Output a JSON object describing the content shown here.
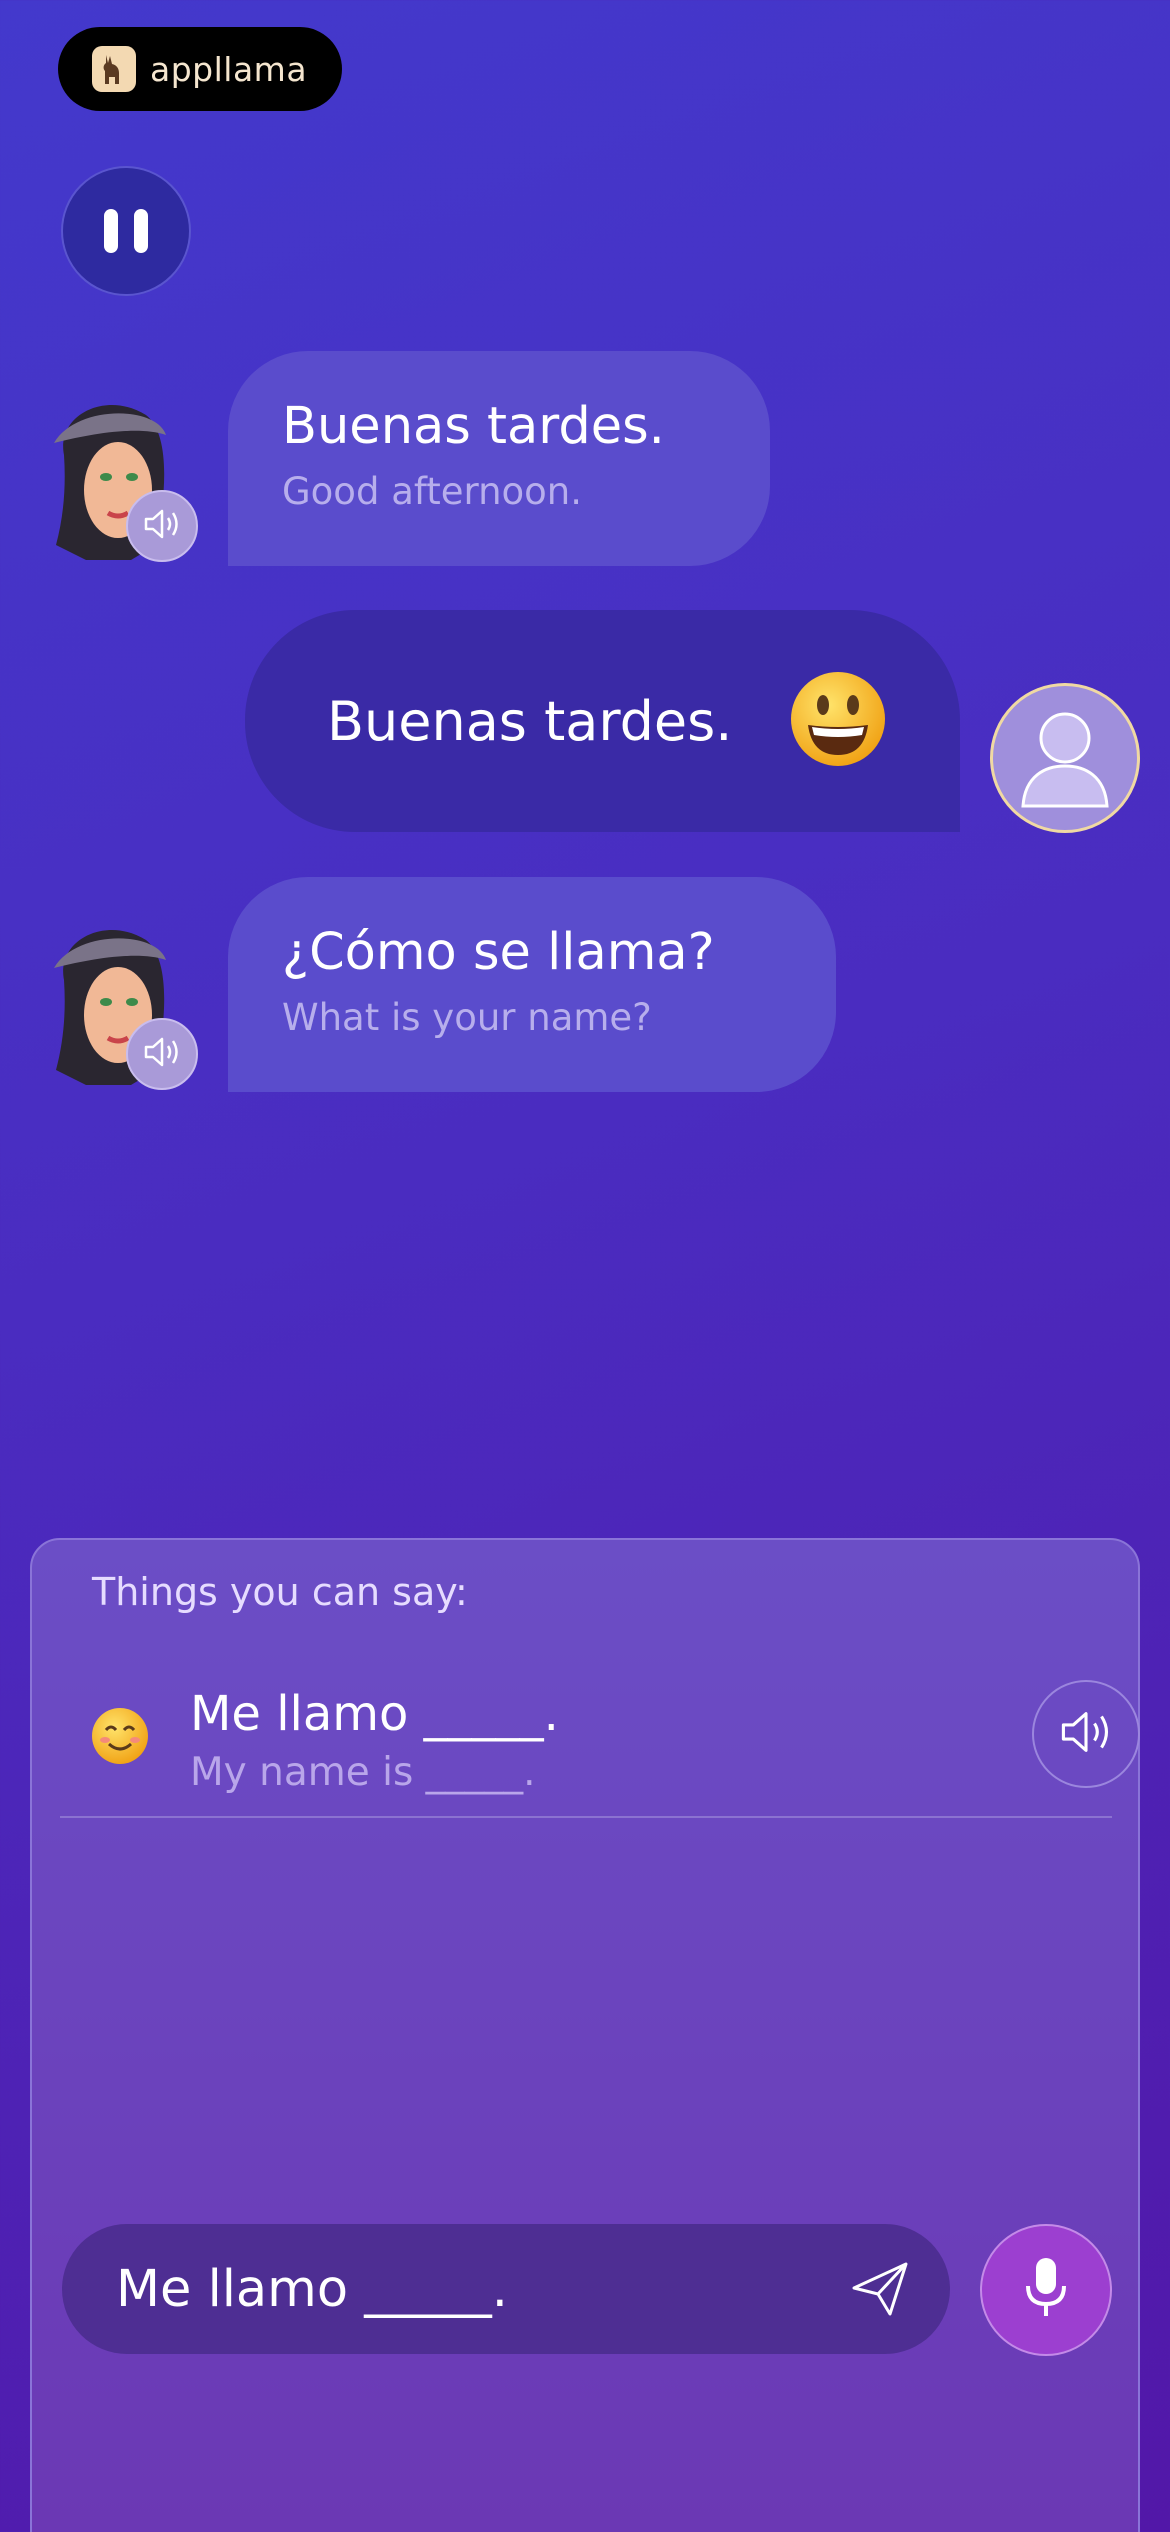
{
  "app": {
    "brand": "appllama"
  },
  "controls": {
    "pause_icon": "pause-icon"
  },
  "conversation": [
    {
      "speaker": "tutor",
      "text": "Buenas tardes.",
      "translation": "Good afternoon."
    },
    {
      "speaker": "user",
      "text": "Buenas tardes.",
      "reaction": "😃"
    },
    {
      "speaker": "tutor",
      "text": "¿Cómo se llama?",
      "translation": "What is your name?"
    }
  ],
  "suggestions": {
    "title": "Things you can say:",
    "items": [
      {
        "emoji": "😊",
        "text": "Me llamo _____.",
        "translation": "My name is _____."
      }
    ]
  },
  "input": {
    "value": "Me llamo _____."
  },
  "colors": {
    "background_top": "#4339cc",
    "background_bottom": "#5217a8",
    "tutor_bubble": "#5a4ccc",
    "user_bubble": "#3a2aa6",
    "mic_button": "#9c3fd0"
  }
}
